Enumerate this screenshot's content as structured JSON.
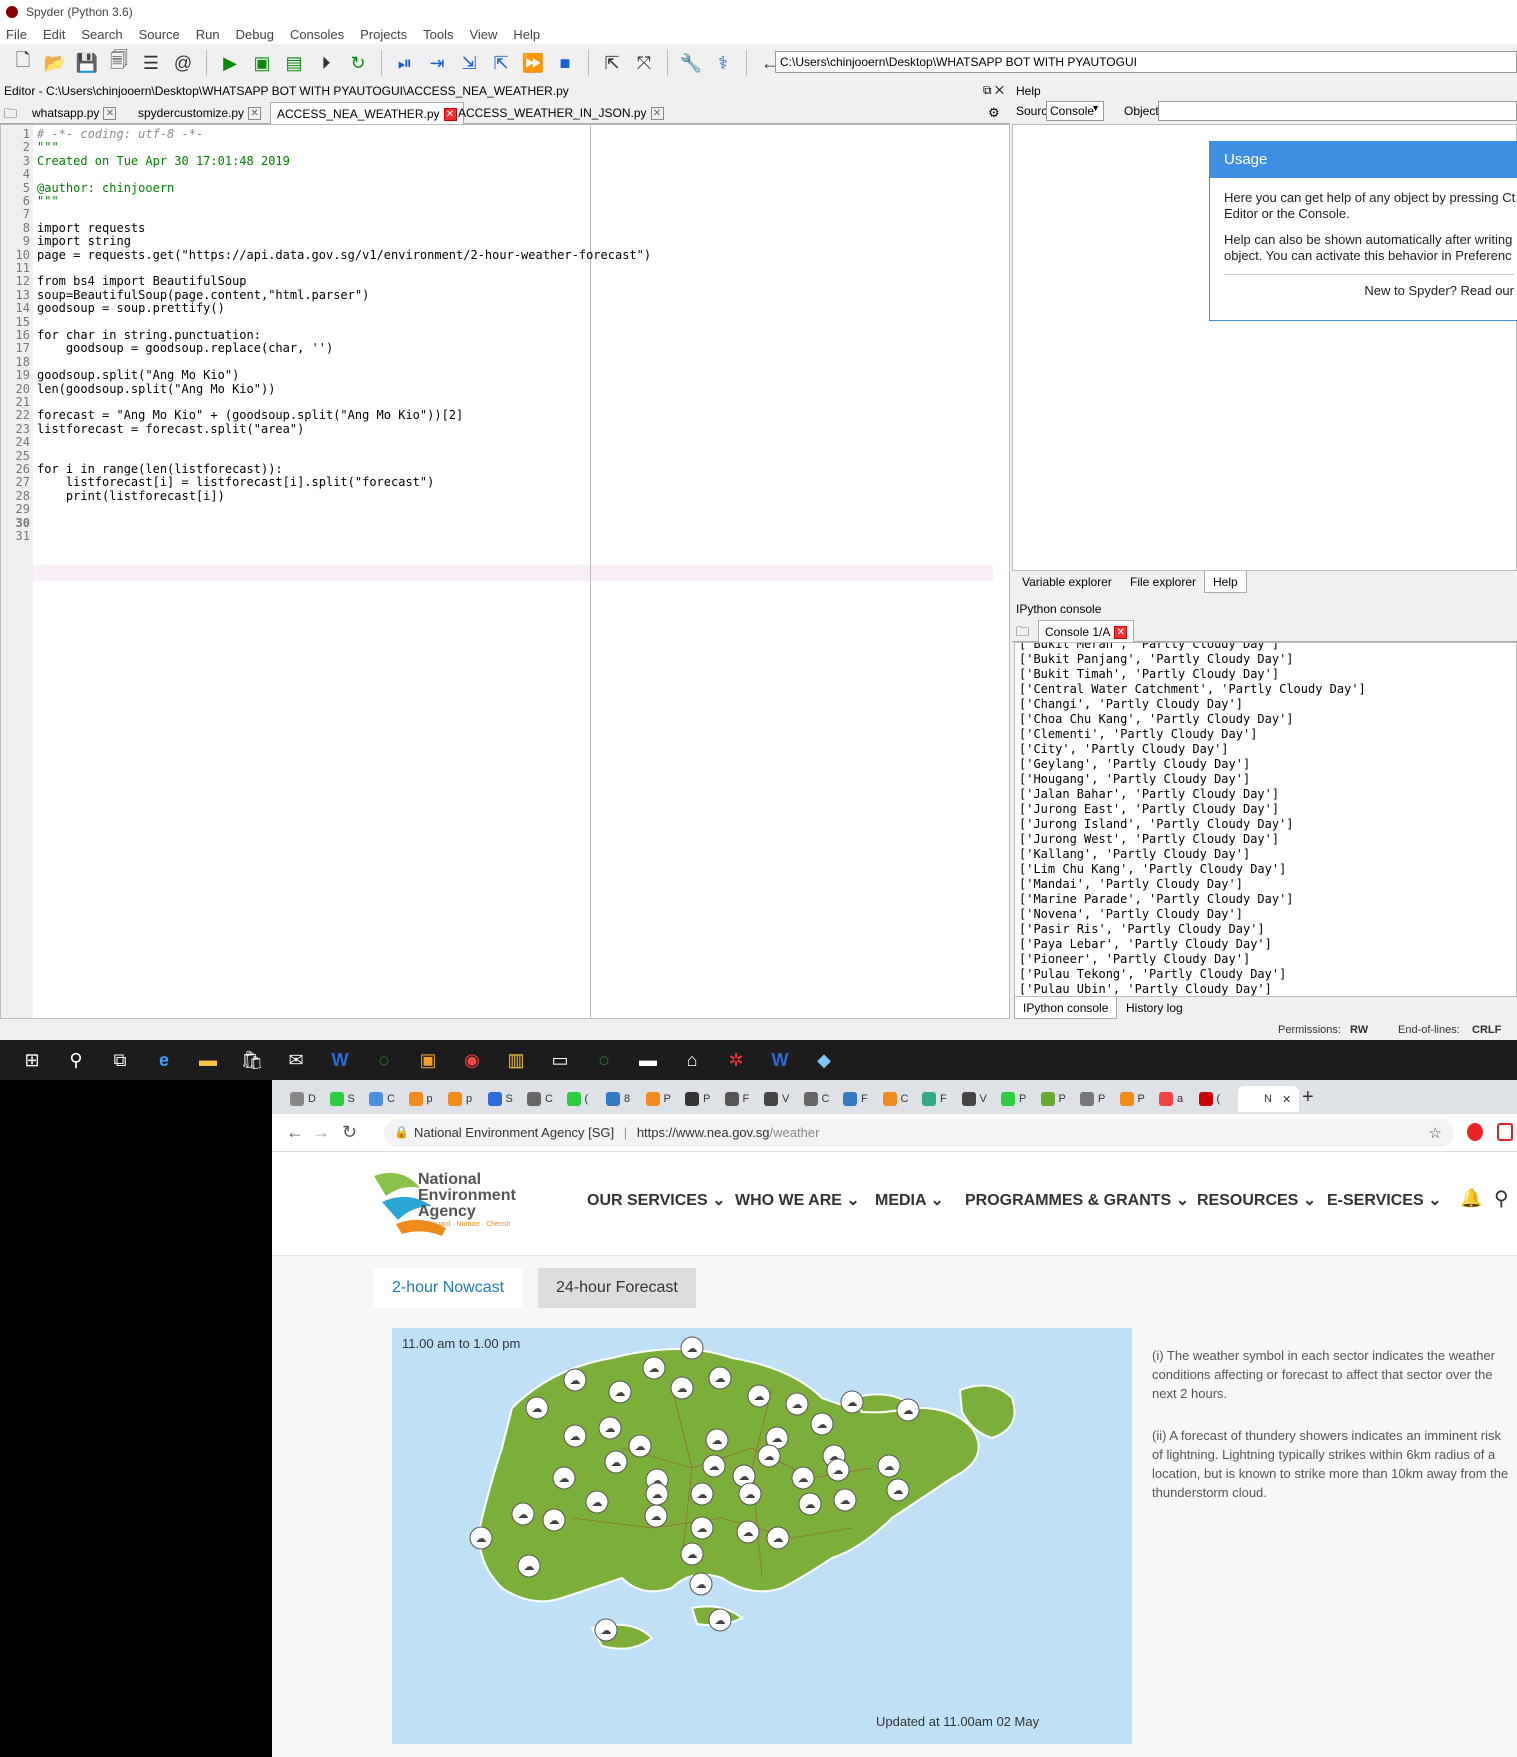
{
  "spyder": {
    "title": "Spyder (Python 3.6)",
    "menu": [
      "File",
      "Edit",
      "Search",
      "Source",
      "Run",
      "Debug",
      "Consoles",
      "Projects",
      "Tools",
      "View",
      "Help"
    ],
    "path": "C:\\Users\\chinjooern\\Desktop\\WHATSAPP BOT WITH PYAUTOGUI",
    "editor_header": "Editor - C:\\Users\\chinjooern\\Desktop\\WHATSAPP BOT WITH PYAUTOGUI\\ACCESS_NEA_WEATHER.py",
    "tabs": [
      "whatsapp.py",
      "spydercustomize.py",
      "ACCESS_NEA_WEATHER.py",
      "ACCESS_WEATHER_IN_JSON.py"
    ],
    "code": [
      "# -*- coding: utf-8 -*-",
      "\"\"\"",
      "Created on Tue Apr 30 17:01:48 2019",
      "",
      "@author: chinjooern",
      "\"\"\"",
      "",
      "import requests",
      "import string",
      "page = requests.get(\"https://api.data.gov.sg/v1/environment/2-hour-weather-forecast\")",
      "",
      "from bs4 import BeautifulSoup",
      "soup=BeautifulSoup(page.content,\"html.parser\")",
      "goodsoup = soup.prettify()",
      "",
      "for char in string.punctuation:",
      "    goodsoup = goodsoup.replace(char, '')",
      "",
      "goodsoup.split(\"Ang Mo Kio\")",
      "len(goodsoup.split(\"Ang Mo Kio\"))",
      "",
      "forecast = \"Ang Mo Kio\" + (goodsoup.split(\"Ang Mo Kio\"))[2]",
      "listforecast = forecast.split(\"area\")",
      "",
      "",
      "for i in range(len(listforecast)):",
      "    listforecast[i] = listforecast[i].split(\"forecast\")",
      "    print(listforecast[i])",
      "",
      "",
      ""
    ],
    "help": {
      "header": "Help",
      "source_label": "Source",
      "source_value": "Console",
      "object_label": "Object",
      "usage_title": "Usage",
      "usage_p1a": "Here you can get help of any object by pressing Ct",
      "usage_p1b": "Editor or the Console.",
      "usage_p2a": "Help can also be shown automatically after writing",
      "usage_p2b": "object. You can activate this behavior in Preferenc",
      "usage_footer": "New to Spyder? Read our",
      "tabs": [
        "Variable explorer",
        "File explorer",
        "Help"
      ]
    },
    "ipython": {
      "header": "IPython console",
      "tab": "Console 1/A",
      "lines": [
        "['Bukit Merah', 'Partly Cloudy Day']",
        "['Bukit Panjang', 'Partly Cloudy Day']",
        "['Bukit Timah', 'Partly Cloudy Day']",
        "['Central Water Catchment', 'Partly Cloudy Day']",
        "['Changi', 'Partly Cloudy Day']",
        "['Choa Chu Kang', 'Partly Cloudy Day']",
        "['Clementi', 'Partly Cloudy Day']",
        "['City', 'Partly Cloudy Day']",
        "['Geylang', 'Partly Cloudy Day']",
        "['Hougang', 'Partly Cloudy Day']",
        "['Jalan Bahar', 'Partly Cloudy Day']",
        "['Jurong East', 'Partly Cloudy Day']",
        "['Jurong Island', 'Partly Cloudy Day']",
        "['Jurong West', 'Partly Cloudy Day']",
        "['Kallang', 'Partly Cloudy Day']",
        "['Lim Chu Kang', 'Partly Cloudy Day']",
        "['Mandai', 'Partly Cloudy Day']",
        "['Marine Parade', 'Partly Cloudy Day']",
        "['Novena', 'Partly Cloudy Day']",
        "['Pasir Ris', 'Partly Cloudy Day']",
        "['Paya Lebar', 'Partly Cloudy Day']",
        "['Pioneer', 'Partly Cloudy Day']",
        "['Pulau Tekong', 'Partly Cloudy Day']",
        "['Pulau Ubin', 'Partly Cloudy Day']"
      ],
      "bottom_tabs": [
        "IPython console",
        "History log"
      ]
    },
    "status": {
      "permissions_label": "Permissions:",
      "permissions_value": "RW",
      "eol_label": "End-of-lines:",
      "eol_value": "CRLF"
    }
  },
  "browser": {
    "tab_letters": [
      "D",
      "S",
      "C",
      "p",
      "p",
      "S",
      "C",
      "(",
      "8",
      "P",
      "P",
      "F",
      "V",
      "C",
      "F",
      "C",
      "F",
      "V",
      "P",
      "P",
      "P",
      "P",
      "a",
      "(",
      "N"
    ],
    "site_name": "National Environment Agency [SG]",
    "url_prefix": "https://www.nea.gov.sg",
    "url_path": "/weather",
    "logo_line1": "National",
    "logo_line2": "Environment",
    "logo_line3": "Agency",
    "logo_tagline": "Safeguard · Nurture · Cherish",
    "nav": [
      "OUR SERVICES",
      "WHO WE ARE",
      "MEDIA",
      "PROGRAMMES & GRANTS",
      "RESOURCES",
      "E-SERVICES"
    ],
    "tabs": [
      "2-hour Nowcast",
      "24-hour Forecast"
    ],
    "map_time": "11.00 am to 1.00 pm",
    "map_updated": "Updated at 11.00am 02 May",
    "info1": "(i) The weather symbol in each sector indicates the weather conditions affecting or forecast to affect that sector over the next 2 hours.",
    "info2": "(ii) A forecast of thundery showers indicates an imminent risk of lightning. Lightning typically strikes within 6km radius of a location, but is known to strike more than 10km away from the thunderstorm cloud."
  }
}
